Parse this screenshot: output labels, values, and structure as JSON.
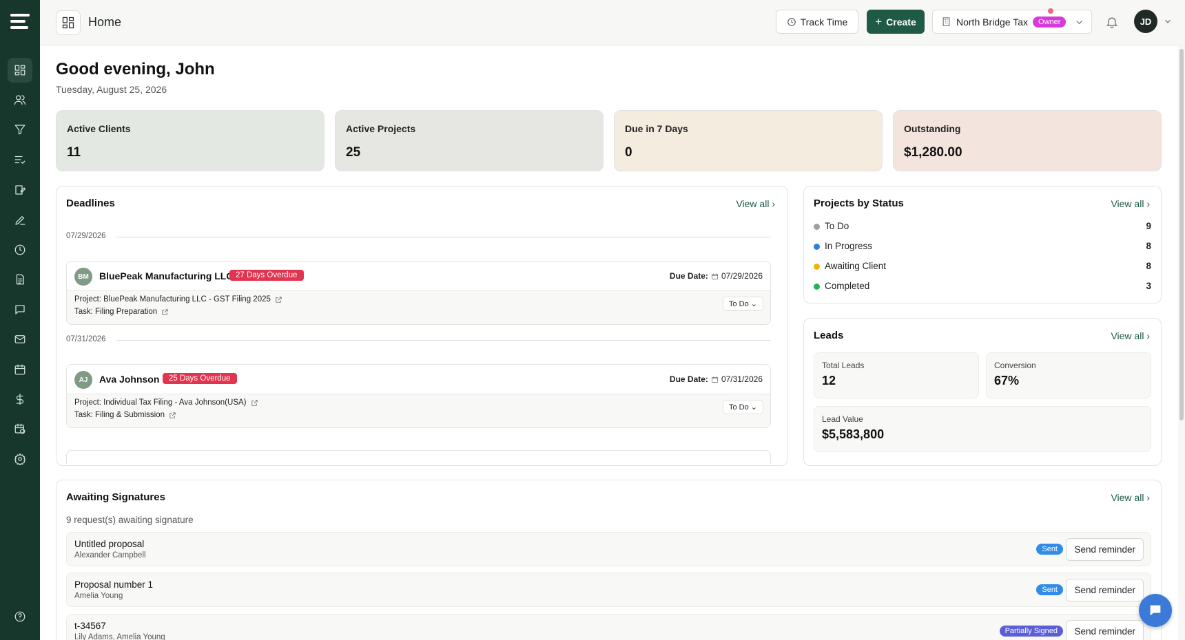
{
  "header": {
    "title": "Home",
    "track_time": "Track Time",
    "create": "Create",
    "org_name": "North Bridge Tax",
    "org_role": "Owner",
    "user_initials": "JD"
  },
  "greeting": {
    "title": "Good evening, John",
    "date": "Tuesday, August 25, 2026"
  },
  "stats": [
    {
      "label": "Active Clients",
      "value": "11",
      "color": "#e3e8e3"
    },
    {
      "label": "Active Projects",
      "value": "25",
      "color": "#e6e7e3"
    },
    {
      "label": "Due in 7 Days",
      "value": "0",
      "color": "#f5ece0"
    },
    {
      "label": "Outstanding",
      "value": "$1,280.00",
      "color": "#f3e5de"
    }
  ],
  "deadlines": {
    "title": "Deadlines",
    "view_all": "View all",
    "groups": [
      {
        "date": "07/29/2026",
        "initials": "BM",
        "client": "BluePeak Manufacturing LLC",
        "overdue": "27 Days Overdue",
        "due_label": "Due Date:",
        "due_date": "07/29/2026",
        "project": "Project: BluePeak Manufacturing LLC - GST Filing 2025",
        "task": "Task: Filing Preparation",
        "status": "To Do"
      },
      {
        "date": "07/31/2026",
        "initials": "AJ",
        "client": "Ava Johnson",
        "overdue": "25 Days Overdue",
        "due_label": "Due Date:",
        "due_date": "07/31/2026",
        "project": "Project: Individual Tax Filing - Ava Johnson(USA)",
        "task": "Task: Filing & Submission",
        "status": "To Do"
      }
    ]
  },
  "projects_by_status": {
    "title": "Projects by Status",
    "view_all": "View all",
    "items": [
      {
        "label": "To Do",
        "count": "9",
        "color": "#9aa0a6"
      },
      {
        "label": "In Progress",
        "count": "8",
        "color": "#2f7de1"
      },
      {
        "label": "Awaiting Client",
        "count": "8",
        "color": "#f0b400"
      },
      {
        "label": "Completed",
        "count": "3",
        "color": "#21b35a"
      }
    ]
  },
  "leads": {
    "title": "Leads",
    "view_all": "View all",
    "total_label": "Total Leads",
    "total_value": "12",
    "conversion_label": "Conversion",
    "conversion_value": "67%",
    "value_label": "Lead Value",
    "value_value": "$5,583,800"
  },
  "signatures": {
    "title": "Awaiting Signatures",
    "view_all": "View all",
    "subtitle": "9 request(s) awaiting signature",
    "items": [
      {
        "name": "Untitled proposal",
        "signer": "Alexander Campbell",
        "status": "Sent",
        "status_color": "#2f8ce8",
        "action": "Send reminder"
      },
      {
        "name": "Proposal number 1",
        "signer": "Amelia Young",
        "status": "Sent",
        "status_color": "#2f8ce8",
        "action": "Send reminder"
      },
      {
        "name": "t-34567",
        "signer": "Lily Adams, Amelia Young",
        "status": "Partially Signed",
        "status_color": "#5b5fd6",
        "action": "Send reminder"
      }
    ]
  }
}
